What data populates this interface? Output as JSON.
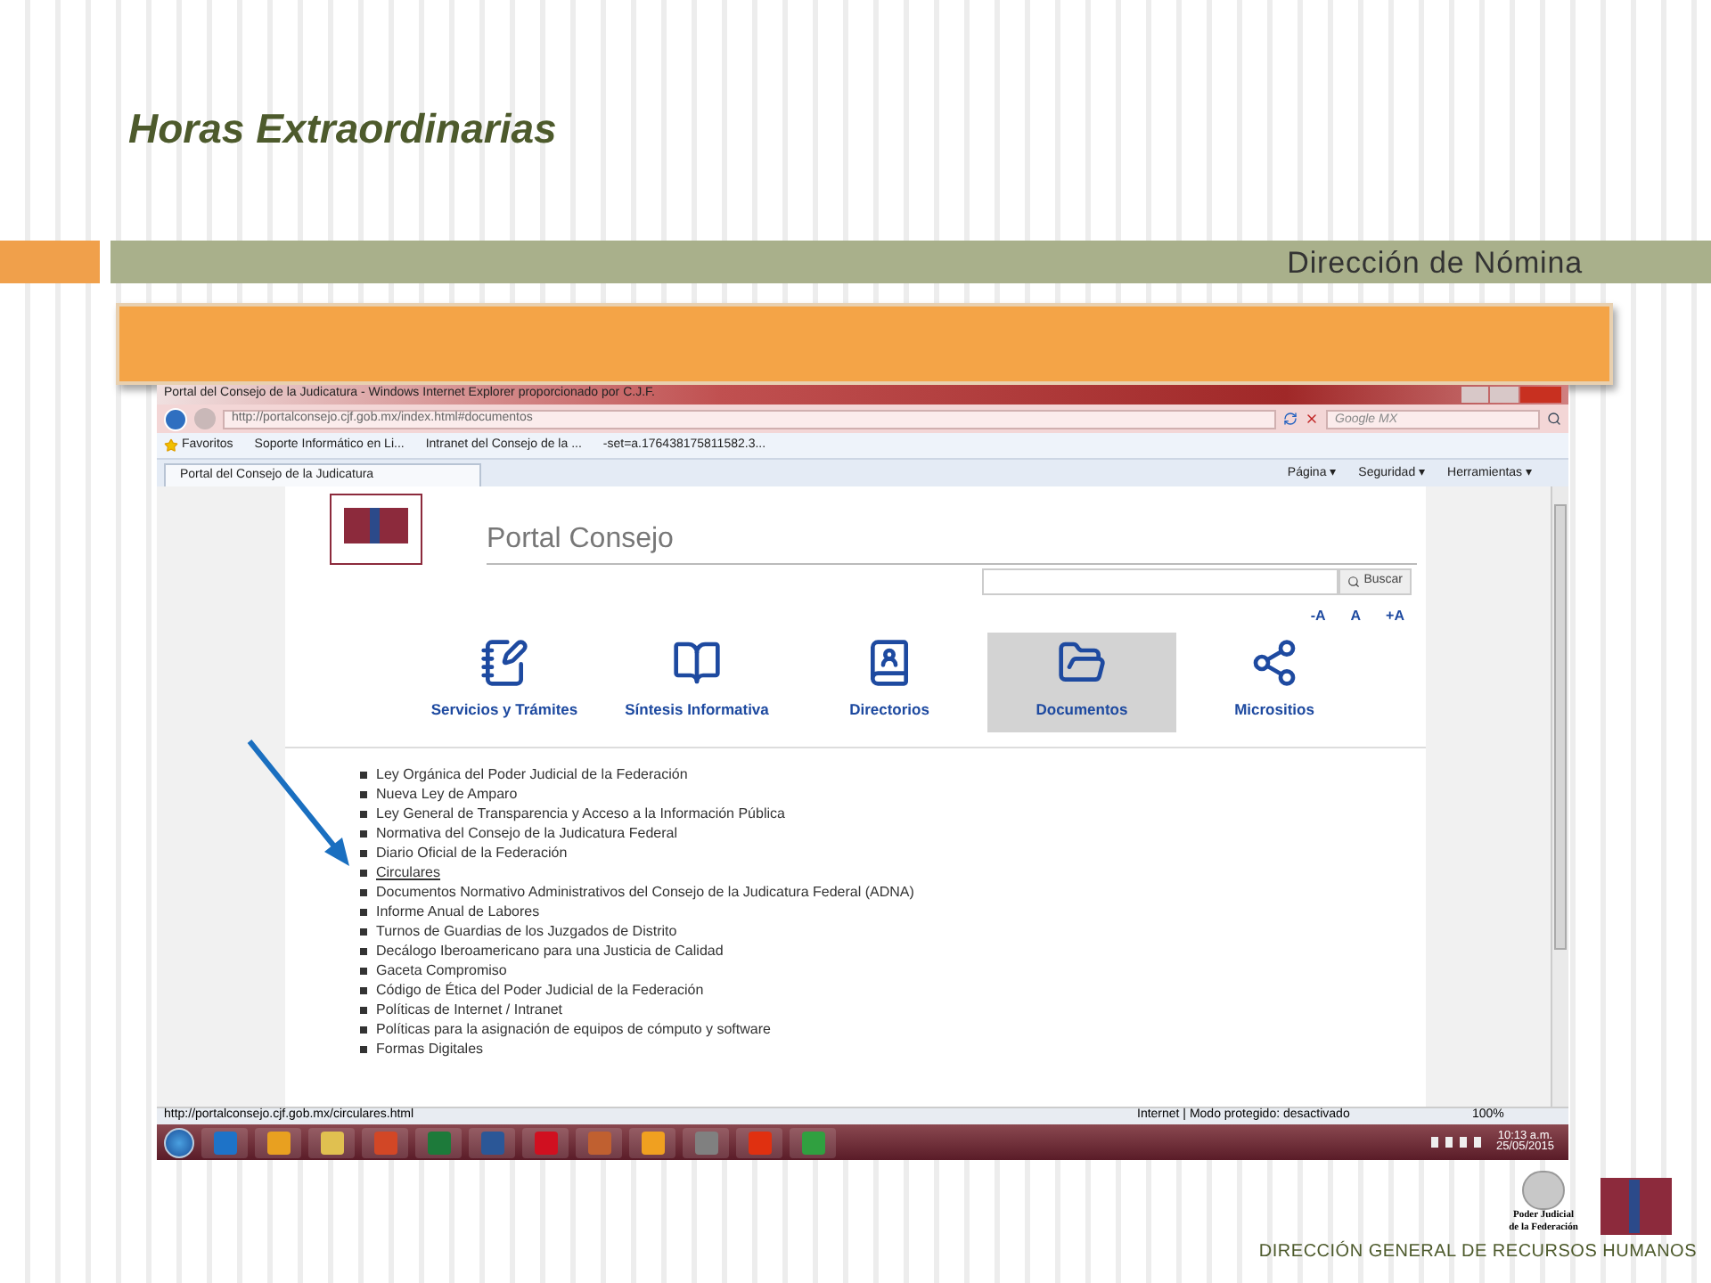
{
  "slide": {
    "title": "Horas Extraordinarias",
    "subtitle": "Dirección de Nómina",
    "footer": "DIRECCIÓN GENERAL DE RECURSOS HUMANOS",
    "seal_caption": "Poder Judicial de la Federación"
  },
  "browser": {
    "window_title": "Portal del Consejo de la Judicatura - Windows Internet Explorer proporcionado por C.J.F.",
    "address": "http://portalconsejo.cjf.gob.mx/index.html#documentos",
    "search_placeholder": "Google MX",
    "favorites": [
      "Favoritos",
      "Soporte Informático en Li...",
      "Intranet del Consejo de la ...",
      "-set=a.176438175811582.3..."
    ],
    "tab": "Portal del Consejo de la Judicatura",
    "commands": [
      "Página ▾",
      "Seguridad ▾",
      "Herramientas ▾"
    ],
    "status_url": "http://portalconsejo.cjf.gob.mx/circulares.html",
    "status_zone": "Internet | Modo protegido: desactivado",
    "zoom": "100%"
  },
  "page": {
    "site_title": "Portal Consejo",
    "search_button": "Buscar",
    "font_sizes": [
      "-A",
      "A",
      "+A"
    ],
    "nav": [
      {
        "label": "Servicios y Trámites",
        "selected": false
      },
      {
        "label": "Síntesis Informativa",
        "selected": false
      },
      {
        "label": "Directorios",
        "selected": false
      },
      {
        "label": "Documentos",
        "selected": true
      },
      {
        "label": "Micrositios",
        "selected": false
      }
    ],
    "documents": [
      {
        "label": "Ley Orgánica del Poder Judicial de la Federación",
        "kind": "text"
      },
      {
        "label": "Nueva Ley de Amparo",
        "kind": "text"
      },
      {
        "label": "Ley General de Transparencia y Acceso a la Información Pública",
        "kind": "text"
      },
      {
        "label": "Normativa del Consejo de la Judicatura Federal",
        "kind": "text"
      },
      {
        "label": "Diario Oficial de la Federación",
        "kind": "text"
      },
      {
        "label": "Circulares",
        "kind": "link"
      },
      {
        "label": "Documentos Normativo Administrativos del Consejo de la Judicatura Federal (ADNA)",
        "kind": "text"
      },
      {
        "label": "Informe Anual de Labores",
        "kind": "text"
      },
      {
        "label": "Turnos de Guardias de los Juzgados de Distrito",
        "kind": "text"
      },
      {
        "label": "Decálogo Iberoamericano para una Justicia de Calidad",
        "kind": "text"
      },
      {
        "label": "Gaceta Compromiso",
        "kind": "text"
      },
      {
        "label": "Código de Ética del Poder Judicial de la Federación",
        "kind": "text"
      },
      {
        "label": "Políticas de Internet / Intranet",
        "kind": "text"
      },
      {
        "label": "Políticas para la asignación de equipos de cómputo y software",
        "kind": "text"
      },
      {
        "label": "Formas Digitales",
        "kind": "text"
      }
    ]
  },
  "taskbar": {
    "apps": [
      {
        "color": "#1e73c8"
      },
      {
        "color": "#e8a020"
      },
      {
        "color": "#e0c050"
      },
      {
        "color": "#d24726"
      },
      {
        "color": "#1d7a3a"
      },
      {
        "color": "#2b5797"
      },
      {
        "color": "#d01020"
      },
      {
        "color": "#c06030"
      },
      {
        "color": "#f0a020"
      },
      {
        "color": "#808080"
      },
      {
        "color": "#e03010"
      },
      {
        "color": "#30a040"
      }
    ],
    "time": "10:13 a.m.",
    "date": "25/05/2015"
  }
}
